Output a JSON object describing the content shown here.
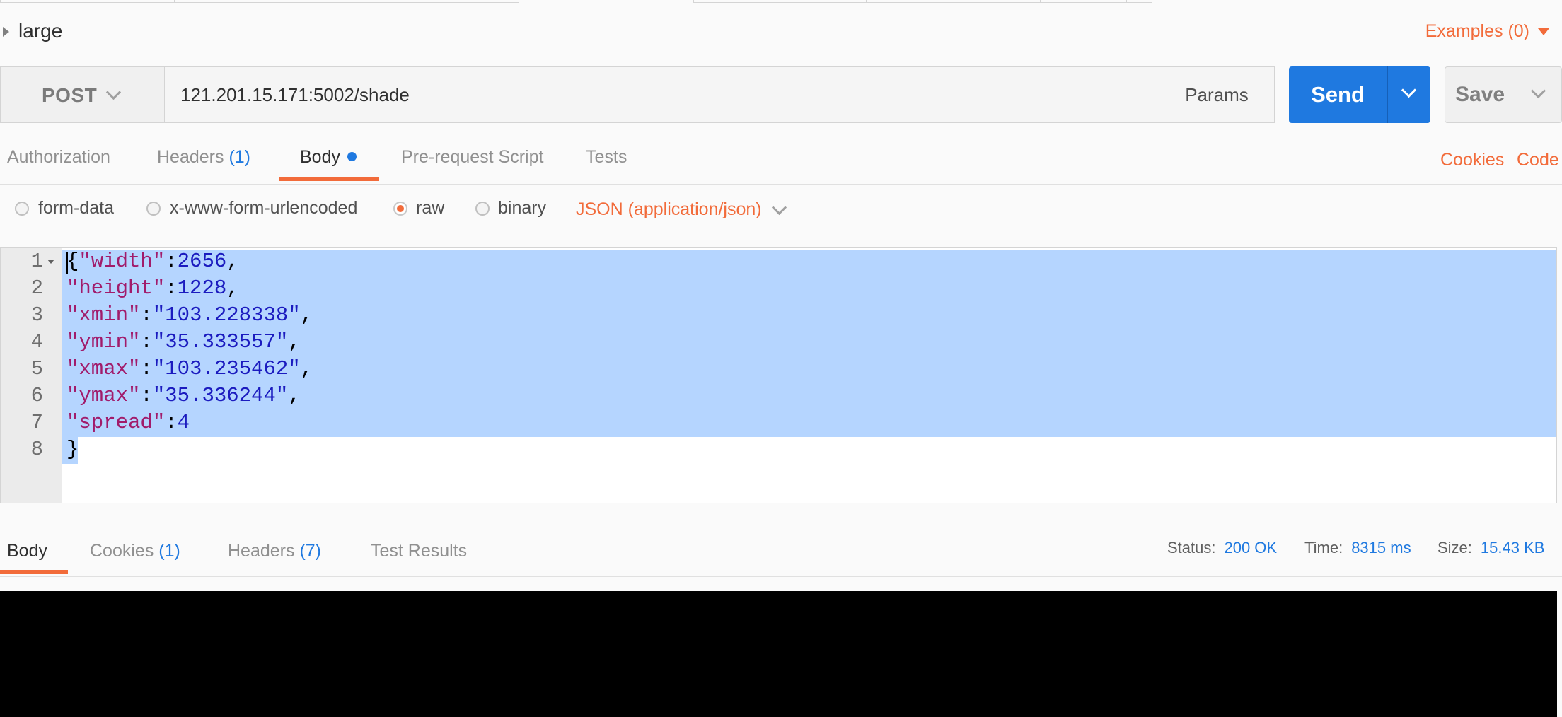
{
  "request": {
    "name": "large",
    "examples_label": "Examples (0)",
    "method": "POST",
    "url": "121.201.15.171:5002/shade",
    "params_label": "Params",
    "send_label": "Send",
    "save_label": "Save"
  },
  "request_tabs": [
    {
      "label": "Authorization",
      "count": ""
    },
    {
      "label": "Headers",
      "count": "(1)"
    },
    {
      "label": "Body",
      "count": ""
    },
    {
      "label": "Pre-request Script",
      "count": ""
    },
    {
      "label": "Tests",
      "count": ""
    }
  ],
  "links": {
    "cookies": "Cookies",
    "code": "Code"
  },
  "body_modes": [
    {
      "label": "form-data",
      "selected": false
    },
    {
      "label": "x-www-form-urlencoded",
      "selected": false
    },
    {
      "label": "raw",
      "selected": true
    },
    {
      "label": "binary",
      "selected": false
    }
  ],
  "content_type": "JSON (application/json)",
  "editor": {
    "line_numbers": [
      "1",
      "2",
      "3",
      "4",
      "5",
      "6",
      "7",
      "8"
    ]
  },
  "response": {
    "tabs": [
      {
        "label": "Body",
        "count": ""
      },
      {
        "label": "Cookies",
        "count": "(1)"
      },
      {
        "label": "Headers",
        "count": "(7)"
      },
      {
        "label": "Test Results",
        "count": ""
      }
    ],
    "status_label": "Status:",
    "status_value": "200 OK",
    "time_label": "Time:",
    "time_value": "8315 ms",
    "size_label": "Size:",
    "size_value": "15.43 KB"
  },
  "colors": {
    "accent": "#f26b3a",
    "primary": "#1f79e0",
    "selection": "#b5d5ff"
  }
}
